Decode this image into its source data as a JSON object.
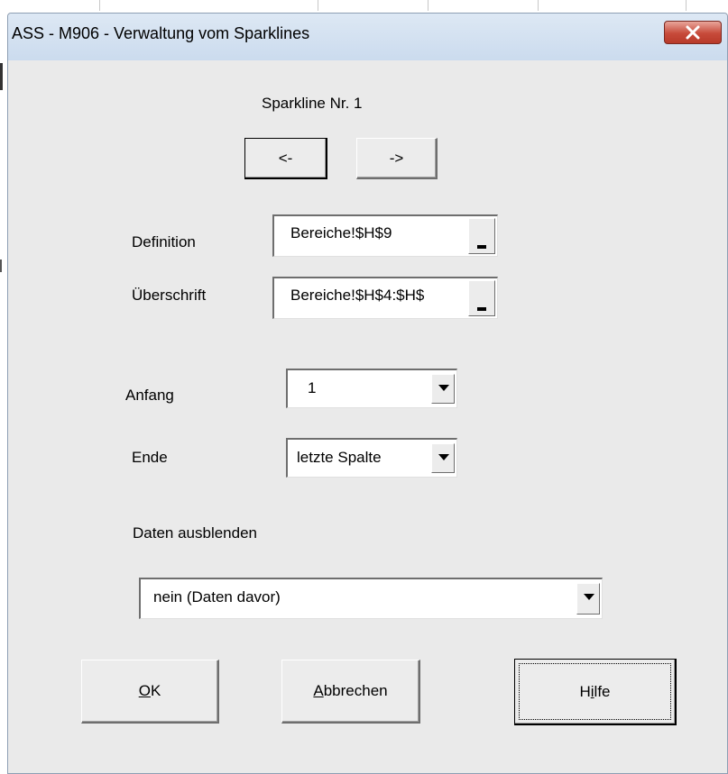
{
  "window": {
    "title": "ASS - M906 - Verwaltung vom Sparklines"
  },
  "header": {
    "sparkline_label": "Sparkline Nr.  1"
  },
  "nav": {
    "prev_label": "<-",
    "next_label": "->"
  },
  "fields": {
    "definition_label": "Definition",
    "definition_value": "Bereiche!$H$9",
    "ueberschrift_label": "Überschrift",
    "ueberschrift_value": "Bereiche!$H$4:$H$"
  },
  "range": {
    "anfang_label": "Anfang",
    "anfang_value": "1",
    "ende_label": "Ende",
    "ende_value": "letzte Spalte"
  },
  "hide": {
    "label": "Daten ausblenden",
    "value": "nein (Daten davor)"
  },
  "buttons": {
    "ok_acc": "O",
    "ok_rest": "K",
    "cancel_acc": "A",
    "cancel_rest": "bbrechen",
    "help_pre": "H",
    "help_acc": "i",
    "help_rest": "lfe"
  },
  "icons": {
    "close": "close-icon",
    "ref_select": "collapse-dialog-icon",
    "dropdown": "chevron-down-icon"
  }
}
